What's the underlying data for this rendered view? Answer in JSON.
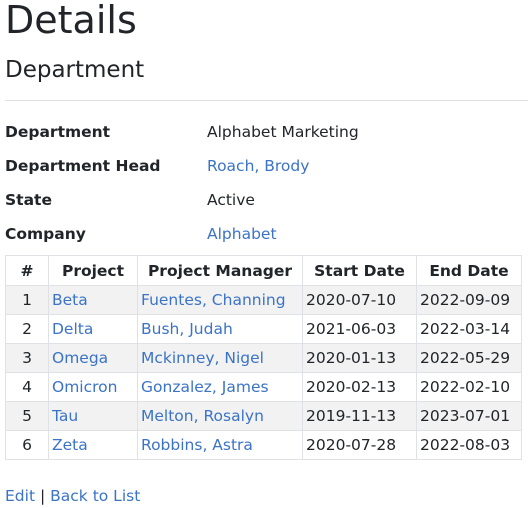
{
  "page": {
    "title": "Details",
    "subtitle": "Department"
  },
  "details": [
    {
      "label": "Department",
      "value": "Alphabet Marketing",
      "is_link": false
    },
    {
      "label": "Department Head",
      "value": "Roach, Brody",
      "is_link": true
    },
    {
      "label": "State",
      "value": "Active",
      "is_link": false
    },
    {
      "label": "Company",
      "value": "Alphabet",
      "is_link": true
    }
  ],
  "projects_table": {
    "headers": [
      "#",
      "Project",
      "Project Manager",
      "Start Date",
      "End Date"
    ],
    "rows": [
      {
        "num": "1",
        "project": "Beta",
        "manager": "Fuentes, Channing",
        "start": "2020-07-10",
        "end": "2022-09-09"
      },
      {
        "num": "2",
        "project": "Delta",
        "manager": "Bush, Judah",
        "start": "2021-06-03",
        "end": "2022-03-14"
      },
      {
        "num": "3",
        "project": "Omega",
        "manager": "Mckinney, Nigel",
        "start": "2020-01-13",
        "end": "2022-05-29"
      },
      {
        "num": "4",
        "project": "Omicron",
        "manager": "Gonzalez, James",
        "start": "2020-02-13",
        "end": "2022-02-10"
      },
      {
        "num": "5",
        "project": "Tau",
        "manager": "Melton, Rosalyn",
        "start": "2019-11-13",
        "end": "2023-07-01"
      },
      {
        "num": "6",
        "project": "Zeta",
        "manager": "Robbins, Astra",
        "start": "2020-07-28",
        "end": "2022-08-03"
      }
    ]
  },
  "footer": {
    "edit_label": "Edit",
    "separator": "|",
    "back_label": "Back to List"
  },
  "colors": {
    "link": "#3b73c6",
    "text": "#212529",
    "stripe": "#f2f2f2",
    "border": "#dee2e6"
  }
}
